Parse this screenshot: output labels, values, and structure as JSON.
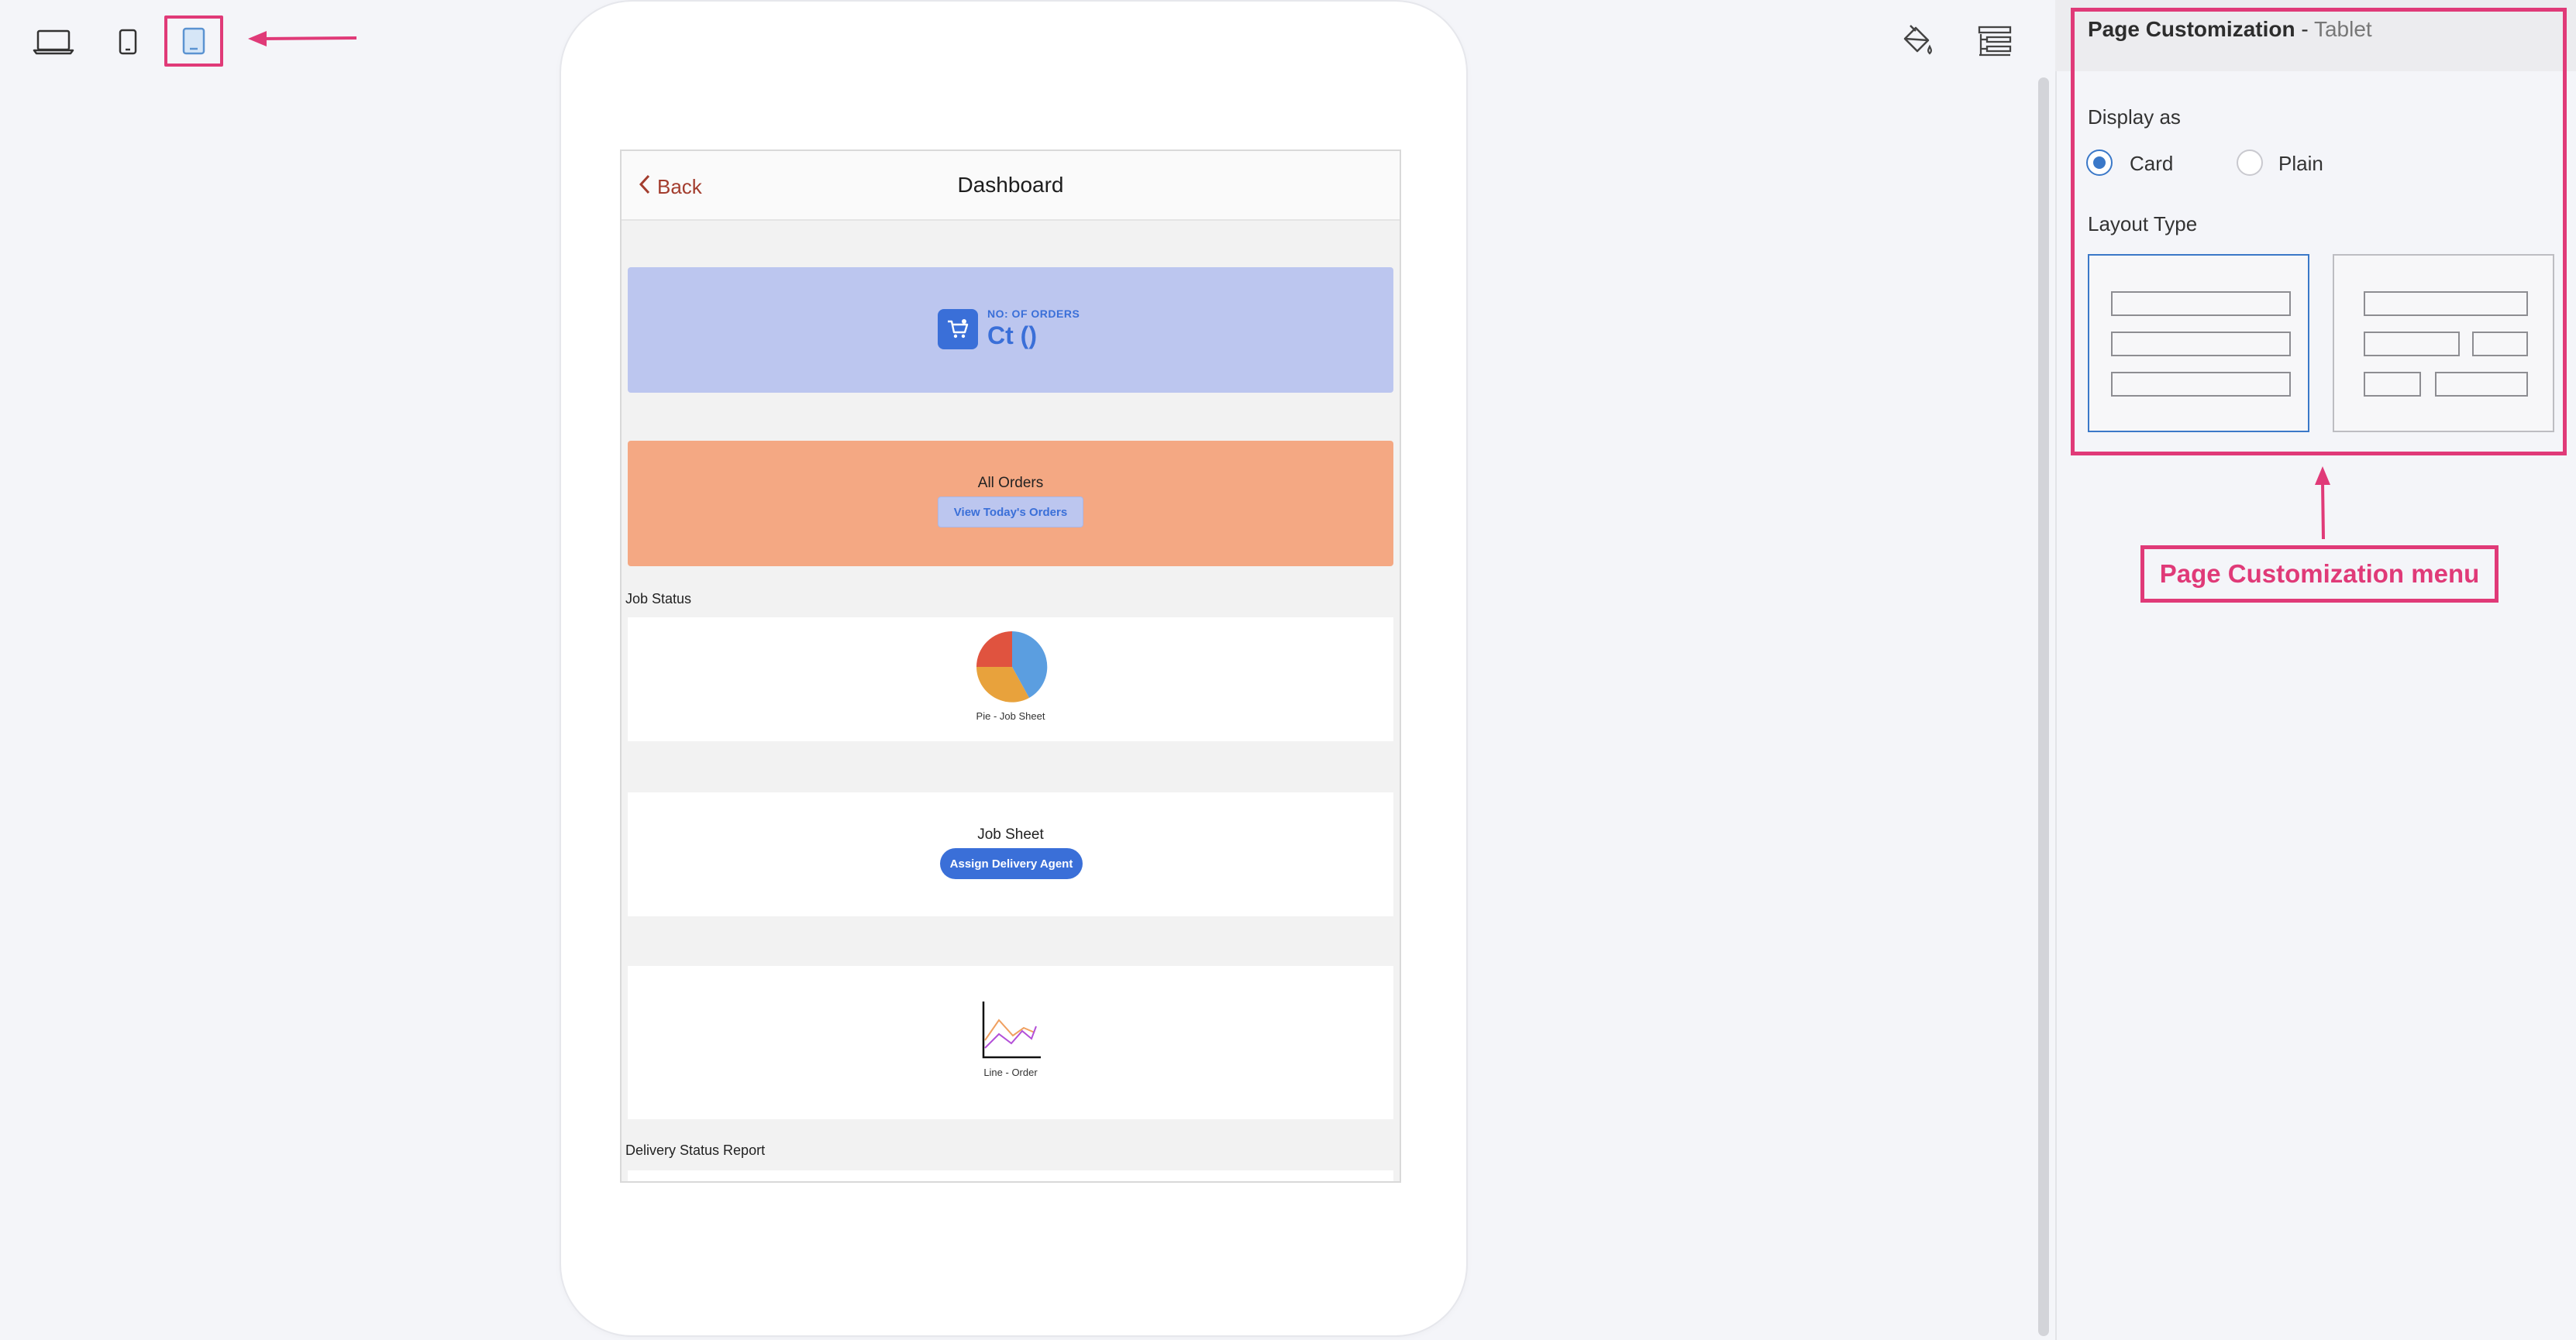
{
  "toolbar": {
    "devices": [
      {
        "name": "desktop",
        "icon": "laptop-icon",
        "selected": false
      },
      {
        "name": "mobile",
        "icon": "phone-icon",
        "selected": false
      },
      {
        "name": "tablet",
        "icon": "tablet-icon",
        "selected": true
      }
    ],
    "right_icons": [
      "paint-bucket-icon",
      "layout-settings-icon"
    ]
  },
  "preview": {
    "header": {
      "back_label": "Back",
      "title": "Dashboard"
    },
    "orders_count": {
      "label": "NO: OF ORDERS",
      "value": "Ct ()",
      "icon": "cart-icon"
    },
    "all_orders": {
      "title": "All Orders",
      "button_label": "View Today's Orders"
    },
    "job_status": {
      "section_label": "Job Status",
      "chart_caption": "Pie - Job Sheet"
    },
    "job_sheet": {
      "title": "Job Sheet",
      "button_label": "Assign Delivery Agent"
    },
    "order_chart": {
      "chart_caption": "Line - Order"
    },
    "delivery_status": {
      "section_label": "Delivery Status Report"
    }
  },
  "panel": {
    "title": "Page Customization",
    "separator": " - ",
    "subtitle": "Tablet",
    "display_as": {
      "label": "Display as",
      "options": [
        {
          "label": "Card",
          "selected": true
        },
        {
          "label": "Plain",
          "selected": false
        }
      ]
    },
    "layout_type": {
      "label": "Layout Type",
      "selected": "single-column"
    }
  },
  "annotation": {
    "callout": "Page Customization menu",
    "color": "#e03a78"
  },
  "colors": {
    "accent": "#3a6fd8",
    "orders_card": "#bcc6ef",
    "all_orders_card": "#f4a883",
    "pie_slices": [
      "#5b9ee0",
      "#e8a23c",
      "#e0533f"
    ],
    "line_series": [
      "#f0a060",
      "#b34fd8"
    ]
  }
}
